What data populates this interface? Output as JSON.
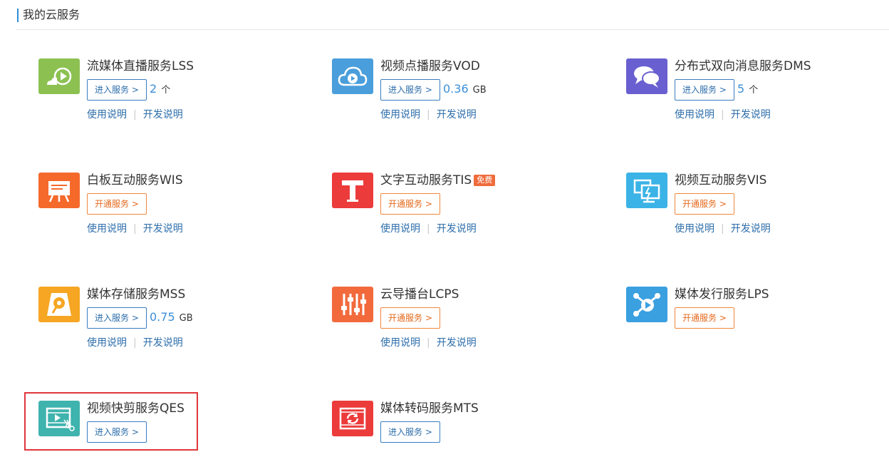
{
  "page": {
    "title": "我的云服务"
  },
  "common": {
    "usage_doc": "使用说明",
    "dev_doc": "开发说明",
    "separator": "|"
  },
  "services": [
    {
      "name": "流媒体直播服务LSS",
      "button": "进入服务 >",
      "usage_value": "2",
      "usage_unit": "个",
      "icon": "live-stream-play-icon",
      "color": "#8cc152"
    },
    {
      "name": "视频点播服务VOD",
      "button": "进入服务 >",
      "usage_value": "0.36",
      "usage_unit": "GB",
      "icon": "cloud-play-icon",
      "color": "#4a9edb"
    },
    {
      "name": "分布式双向消息服务DMS",
      "button": "进入服务 >",
      "usage_value": "5",
      "usage_unit": "个",
      "icon": "chat-bubbles-icon",
      "color": "#6a5fd0"
    },
    {
      "name": "白板互动服务WIS",
      "button": "开通服务 >",
      "icon": "whiteboard-icon",
      "color": "#f5692b"
    },
    {
      "name": "文字互动服务TIS",
      "badge": "免费",
      "button": "开通服务 >",
      "icon": "text-t-icon",
      "color": "#ec3b3b"
    },
    {
      "name": "视频互动服务VIS",
      "button": "开通服务 >",
      "icon": "monitor-interaction-icon",
      "color": "#3bb3e6"
    },
    {
      "name": "媒体存储服务MSS",
      "button": "进入服务 >",
      "usage_value": "0.75",
      "usage_unit": "GB",
      "icon": "storage-disk-icon",
      "color": "#f6a623"
    },
    {
      "name": "云导播台LCPS",
      "button": "开通服务 >",
      "icon": "mixer-sliders-icon",
      "color": "#f26a3c"
    },
    {
      "name": "媒体发行服务LPS",
      "button": "开通服务 >",
      "icon": "distribution-share-icon",
      "color": "#3aa0e0"
    },
    {
      "name": "视频快剪服务QES",
      "button": "进入服务 >",
      "icon": "film-scissors-icon",
      "color": "#3fb3ad"
    },
    {
      "name": "媒体转码服务MTS",
      "button": "进入服务 >",
      "icon": "film-refresh-icon",
      "color": "#ec3b3b"
    }
  ]
}
